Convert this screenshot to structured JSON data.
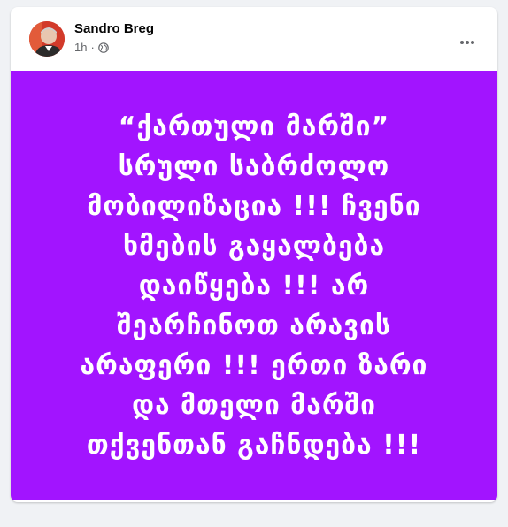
{
  "post": {
    "author": "Sandro Breg",
    "timestamp": "1h",
    "separator": "·",
    "privacy_icon": "globe-icon",
    "more_icon": "more-horizontal-icon",
    "body_background": "#a214ff",
    "text": "“ქართული მარში”\nსრული საბრძოლო\nმობილიზაცია !!! ჩვენი\nხმების გაყალბება\nდაიწყება !!! არ\nშეარჩინოთ არავის\nარაფერი !!! ერთი ზარი\nდა მთელი მარში\nთქვენთან გაჩნდება !!!"
  }
}
